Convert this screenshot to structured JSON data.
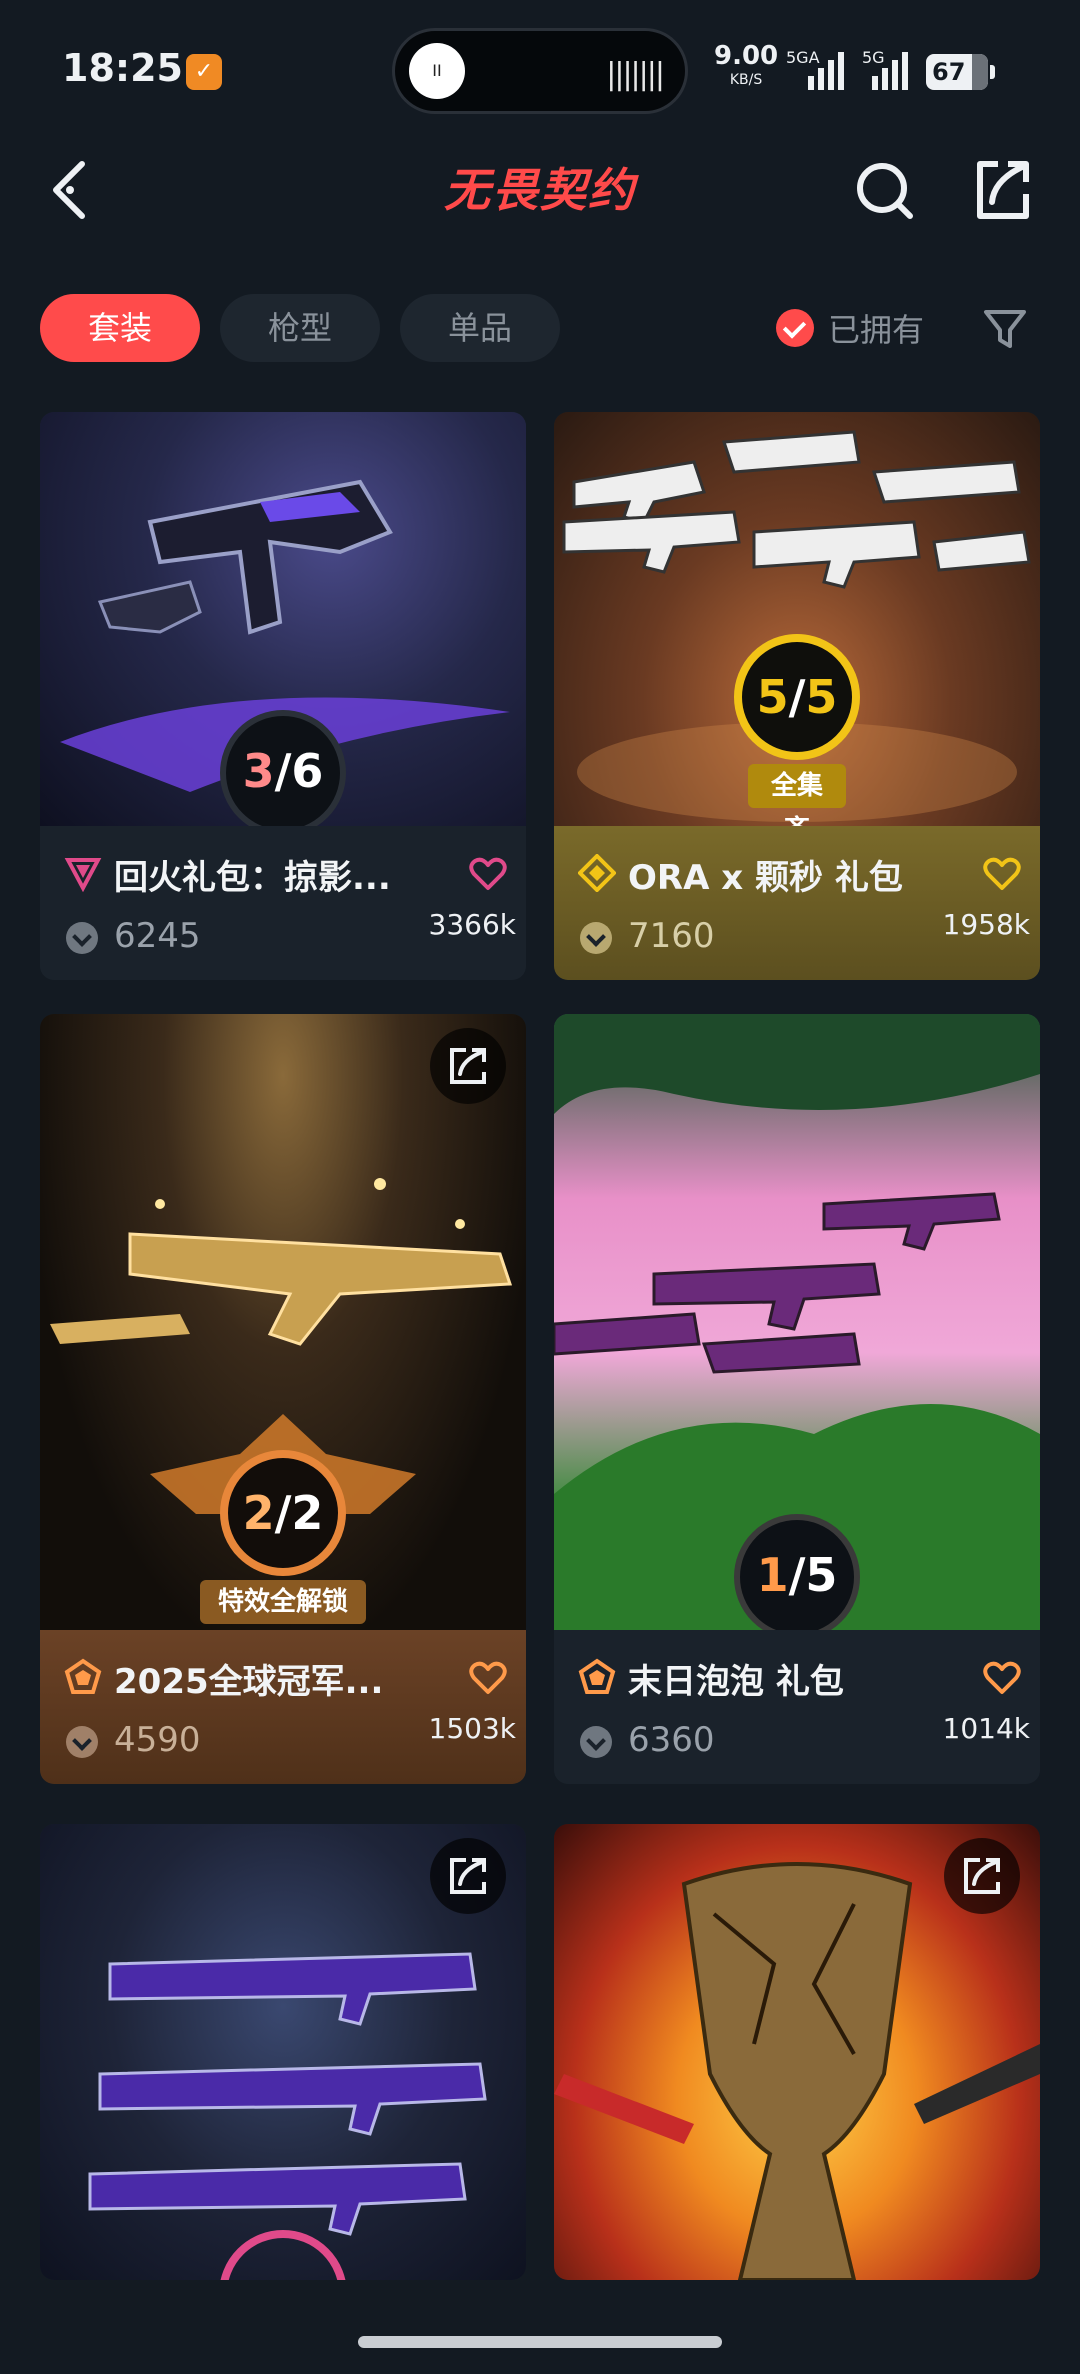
{
  "status_bar": {
    "time": "18:25",
    "app_icon": "app-notification-icon",
    "speed_value": "9.00",
    "speed_unit": "KB/S",
    "signal1_label": "5GA",
    "signal2_label": "5G",
    "battery": "67"
  },
  "header": {
    "title": "无畏契约"
  },
  "tabs": [
    {
      "label": "套装",
      "active": true
    },
    {
      "label": "枪型",
      "active": false
    },
    {
      "label": "单品",
      "active": false
    }
  ],
  "owned_filter": {
    "label": "已拥有",
    "checked": true
  },
  "cards": [
    {
      "name": "回火礼包：掠影...",
      "price": "6245",
      "likes": "3366k",
      "progress": "3/6",
      "progress_num": "3",
      "progress_den": "6",
      "tier_color": "#e04a8a",
      "style": "dark"
    },
    {
      "name": "ORA x 颗秒 礼包",
      "price": "7160",
      "likes": "1958k",
      "progress": "5/5",
      "progress_num": "5",
      "progress_den": "5",
      "ribbon": "全集齐",
      "tier_color": "#f2c417",
      "style": "gold"
    },
    {
      "name": "2025全球冠军...",
      "price": "4590",
      "likes": "1503k",
      "progress": "2/2",
      "progress_num": "2",
      "progress_den": "2",
      "ribbon": "特效全解锁",
      "tier_color": "#ff9a4a",
      "style": "bronze"
    },
    {
      "name": "末日泡泡 礼包",
      "price": "6360",
      "likes": "1014k",
      "progress": "1/5",
      "progress_num": "1",
      "progress_den": "5",
      "tier_color": "#ff9a4a",
      "style": "dark"
    },
    {
      "name": "",
      "price": "",
      "likes": "",
      "style": "dark"
    },
    {
      "name": "",
      "price": "",
      "likes": "",
      "style": "dark"
    }
  ],
  "colors": {
    "accent": "#ff4b4b",
    "background": "#131a22",
    "heart_pink": "#e04a8a",
    "heart_gold": "#f2c417",
    "heart_orange": "#ff9a4a"
  }
}
